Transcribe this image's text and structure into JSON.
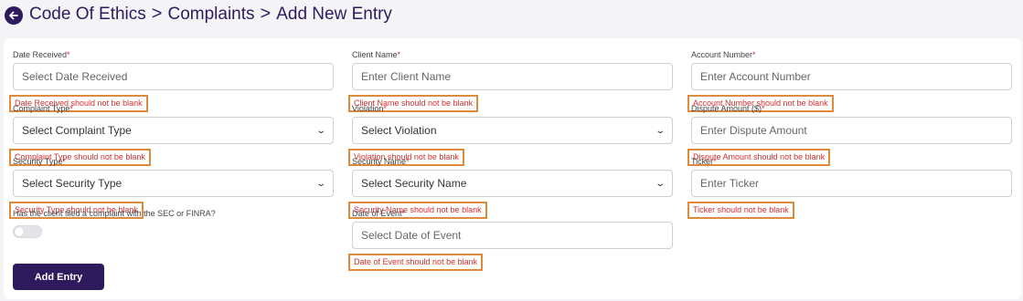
{
  "breadcrumb": {
    "items": [
      "Code Of Ethics",
      "Complaints",
      "Add New Entry"
    ],
    "separator": ">"
  },
  "form": {
    "date_received": {
      "label": "Date Received",
      "placeholder": "Select Date Received",
      "error": "Date Received should not be blank"
    },
    "client_name": {
      "label": "Client Name",
      "placeholder": "Enter Client Name",
      "error": "Client Name should not be blank"
    },
    "account_number": {
      "label": "Account Number",
      "placeholder": "Enter Account Number",
      "error": "Account Number should not be blank"
    },
    "complaint_type": {
      "label": "Complaint Type",
      "value": "Select Complaint Type",
      "error": "Complaint Type should not be blank"
    },
    "violation": {
      "label": "Violation",
      "value": "Select Violation",
      "error": "Violation should not be blank"
    },
    "dispute_amount": {
      "label": "Dispute Amount ($)",
      "placeholder": "Enter Dispute Amount",
      "error": "Dispute Amount should not be blank"
    },
    "security_type": {
      "label": "Security Type",
      "value": "Select Security Type",
      "error": "Security Type should not be blank"
    },
    "security_name": {
      "label": "Security Name",
      "value": "Select Security Name",
      "error": "Security Name should not be blank"
    },
    "ticker": {
      "label": "Ticker",
      "placeholder": "Enter Ticker",
      "error": "Ticker should not be blank"
    },
    "sec_finra_complaint": {
      "label": "Has the client filed a complaint with the SEC or FINRA?",
      "toggle_on": false
    },
    "date_of_event": {
      "label": "Date of Event",
      "placeholder": "Select Date of Event",
      "error": "Date of Event should not be blank"
    },
    "required_marker": "*",
    "submit_label": "Add Entry"
  },
  "colors": {
    "brand": "#2d1b5e",
    "error_text": "#d32f2f",
    "error_highlight": "#e08a3c"
  }
}
